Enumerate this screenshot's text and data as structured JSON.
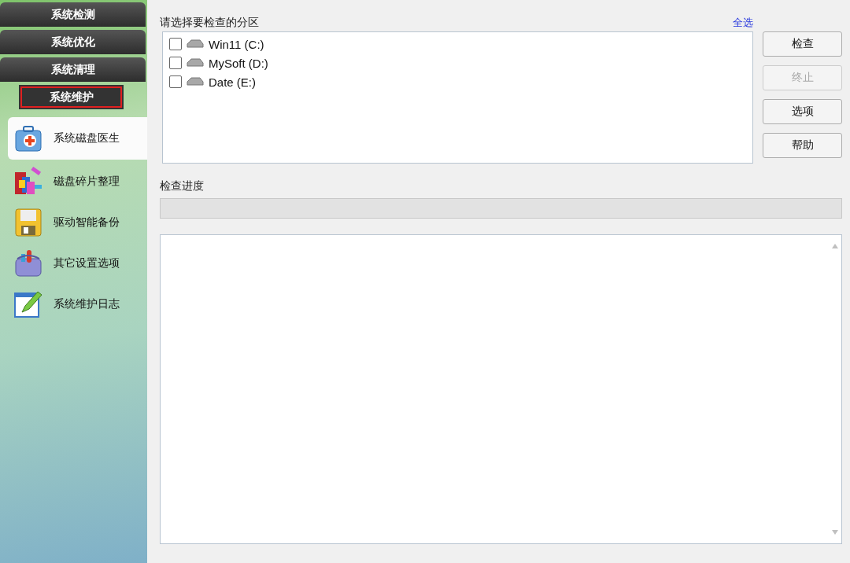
{
  "categories": [
    {
      "label": "系统检测",
      "selected": false
    },
    {
      "label": "系统优化",
      "selected": false
    },
    {
      "label": "系统清理",
      "selected": false
    },
    {
      "label": "系统维护",
      "selected": true
    }
  ],
  "tools": [
    {
      "label": "系统磁盘医生",
      "selected": true
    },
    {
      "label": "磁盘碎片整理",
      "selected": false
    },
    {
      "label": "驱动智能备份",
      "selected": false
    },
    {
      "label": "其它设置选项",
      "selected": false
    },
    {
      "label": "系统维护日志",
      "selected": false
    }
  ],
  "partitions": {
    "label": "请选择要检查的分区",
    "select_all": "全选",
    "items": [
      {
        "label": "Win11 (C:)",
        "checked": false
      },
      {
        "label": "MySoft (D:)",
        "checked": false
      },
      {
        "label": "Date (E:)",
        "checked": false
      }
    ]
  },
  "buttons": [
    {
      "label": "检查",
      "disabled": false
    },
    {
      "label": "终止",
      "disabled": true
    },
    {
      "label": "选项",
      "disabled": false
    },
    {
      "label": "帮助",
      "disabled": false
    }
  ],
  "progress": {
    "label": "检查进度",
    "level": 0
  }
}
